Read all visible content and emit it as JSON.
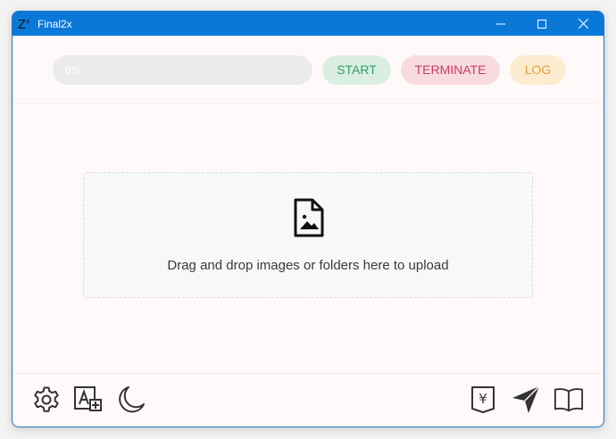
{
  "window": {
    "title": "Final2x",
    "accent": "#0a78d7"
  },
  "toolbar": {
    "progress_label": "0%",
    "start_label": "START",
    "terminate_label": "TERMINATE",
    "log_label": "LOG"
  },
  "dropzone": {
    "text": "Drag and drop images or folders here to upload"
  },
  "footer": {
    "left_icons": [
      "gear-icon",
      "translate-icon",
      "moon-icon"
    ],
    "right_icons": [
      "yen-bookmark-icon",
      "send-icon",
      "book-icon"
    ]
  }
}
